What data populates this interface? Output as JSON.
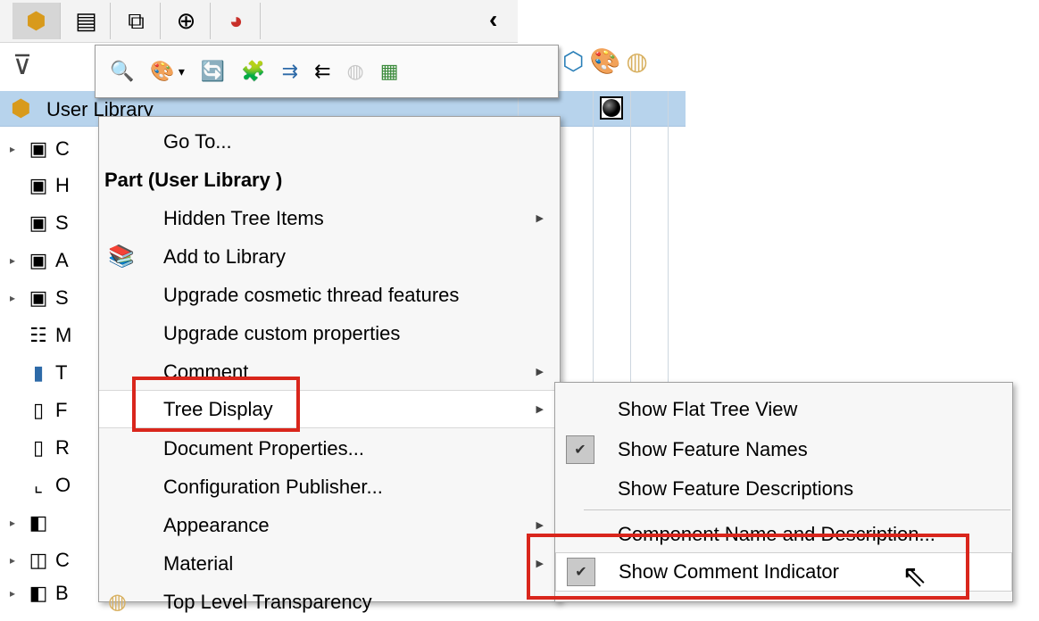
{
  "tabs": [
    {
      "name": "tab-feature-manager",
      "icon": "feature-manager-icon",
      "glyph": "⬢"
    },
    {
      "name": "tab-property-manager",
      "icon": "property-manager-icon",
      "glyph": "▤"
    },
    {
      "name": "tab-configuration-manager",
      "icon": "configuration-manager-icon",
      "glyph": "⧉"
    },
    {
      "name": "tab-dimxpert",
      "icon": "dimxpert-icon",
      "glyph": "⊕"
    },
    {
      "name": "tab-display-manager",
      "icon": "display-manager-icon",
      "glyph": "◕"
    }
  ],
  "collapse_glyph": "‹",
  "filter_glyph": "⊽",
  "toolbar_icons": [
    {
      "name": "zoom-icon",
      "glyph": "🔍"
    },
    {
      "name": "edit-appearance-icon",
      "glyph": "🎨"
    },
    {
      "name": "dropdown-arrow-icon",
      "glyph": "▾"
    },
    {
      "name": "copy-appearance-icon",
      "glyph": "🔄"
    },
    {
      "name": "paste-appearance-icon",
      "glyph": "🧩"
    },
    {
      "name": "expand-tree-icon",
      "glyph": "⇉"
    },
    {
      "name": "collapse-tree-icon",
      "glyph": "⇇"
    },
    {
      "name": "transparency-icon",
      "glyph": "◍"
    },
    {
      "name": "display-pane-icon",
      "glyph": "▦"
    }
  ],
  "column_icons": [
    {
      "name": "display-mode-icon",
      "glyph": "⬡"
    },
    {
      "name": "appearance-column-icon",
      "glyph": "🎨"
    },
    {
      "name": "transparency-column-icon",
      "glyph": "◍"
    }
  ],
  "root": {
    "icon": "part-icon",
    "glyph": "⬢",
    "label": "User Library"
  },
  "tree": [
    {
      "arrow": "▸",
      "glyph": "▣",
      "label": "C",
      "icon": "folder-icon"
    },
    {
      "arrow": "",
      "glyph": "▣",
      "label": "H",
      "icon": "history-folder-icon"
    },
    {
      "arrow": "",
      "glyph": "▣",
      "label": "S",
      "icon": "sensors-folder-icon"
    },
    {
      "arrow": "▸",
      "glyph": "▣",
      "label": "A",
      "icon": "annotations-folder-icon"
    },
    {
      "arrow": "▸",
      "glyph": "▣",
      "label": "S",
      "icon": "solid-bodies-folder-icon"
    },
    {
      "arrow": "",
      "glyph": "☷",
      "label": "M",
      "icon": "material-icon"
    },
    {
      "arrow": "",
      "glyph": "▮",
      "label": "T",
      "icon": "top-plane-icon"
    },
    {
      "arrow": "",
      "glyph": "▯",
      "label": "F",
      "icon": "front-plane-icon"
    },
    {
      "arrow": "",
      "glyph": "▯",
      "label": "R",
      "icon": "right-plane-icon"
    },
    {
      "arrow": "",
      "glyph": "⌞",
      "label": "O",
      "icon": "origin-icon"
    },
    {
      "arrow": "▸",
      "glyph": "◧",
      "label": "",
      "icon": "feature-icon"
    },
    {
      "arrow": "▸",
      "glyph": "◫",
      "label": "C",
      "icon": "feature-icon"
    },
    {
      "arrow": "▸",
      "glyph": "◧",
      "label": "B",
      "icon": "feature-icon"
    }
  ],
  "menu": {
    "go_to": "Go To...",
    "header": "Part (User Library )",
    "hidden_tree_items": "Hidden Tree Items",
    "add_to_library": "Add to Library",
    "upgrade_cosmetic": "Upgrade cosmetic thread features",
    "upgrade_custom": "Upgrade custom properties",
    "comment": "Comment",
    "tree_display": "Tree Display",
    "document_properties": "Document Properties...",
    "configuration_publisher": "Configuration Publisher...",
    "appearance": "Appearance",
    "material": "Material",
    "top_level_transparency": "Top Level Transparency",
    "submenu_arrow": "▶",
    "add_library_glyph": "📚"
  },
  "submenu": {
    "flat_tree": "Show Flat Tree View",
    "feature_names": "Show Feature Names",
    "feature_descriptions": "Show Feature Descriptions",
    "component_name": "Component Name and Description...",
    "comment_indicator": "Show Comment Indicator",
    "check_glyph": "✔"
  },
  "cursor_glyph": "⇖",
  "colors": {
    "selection": "#b7d3ec",
    "highlight_box": "#d9261c",
    "menu_bg": "#f7f7f7"
  }
}
